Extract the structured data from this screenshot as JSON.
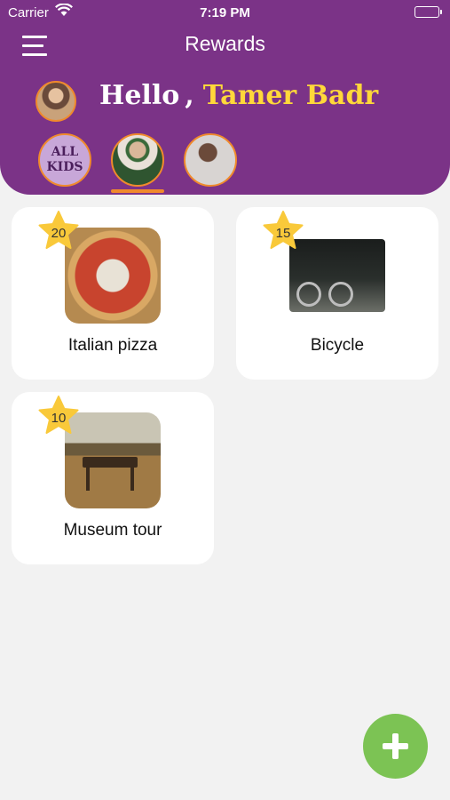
{
  "status_bar": {
    "carrier": "Carrier",
    "time": "7:19 PM"
  },
  "nav": {
    "title": "Rewards"
  },
  "greeting": {
    "hello": "Hello",
    "comma": ",",
    "name": "Tamer Badr"
  },
  "kids": {
    "all_line1": "ALL",
    "all_line2": "KIDS"
  },
  "rewards": [
    {
      "title": "Italian pizza",
      "points": "20"
    },
    {
      "title": "Bicycle",
      "points": "15"
    },
    {
      "title": "Museum tour",
      "points": "10"
    }
  ],
  "colors": {
    "header": "#7b3387",
    "name": "#ffd83a",
    "accent": "#f08a2c",
    "star": "#f9c93a",
    "fab": "#7cc354"
  },
  "icons": {
    "menu": "menu-icon",
    "add": "plus-icon",
    "star": "star-icon"
  }
}
